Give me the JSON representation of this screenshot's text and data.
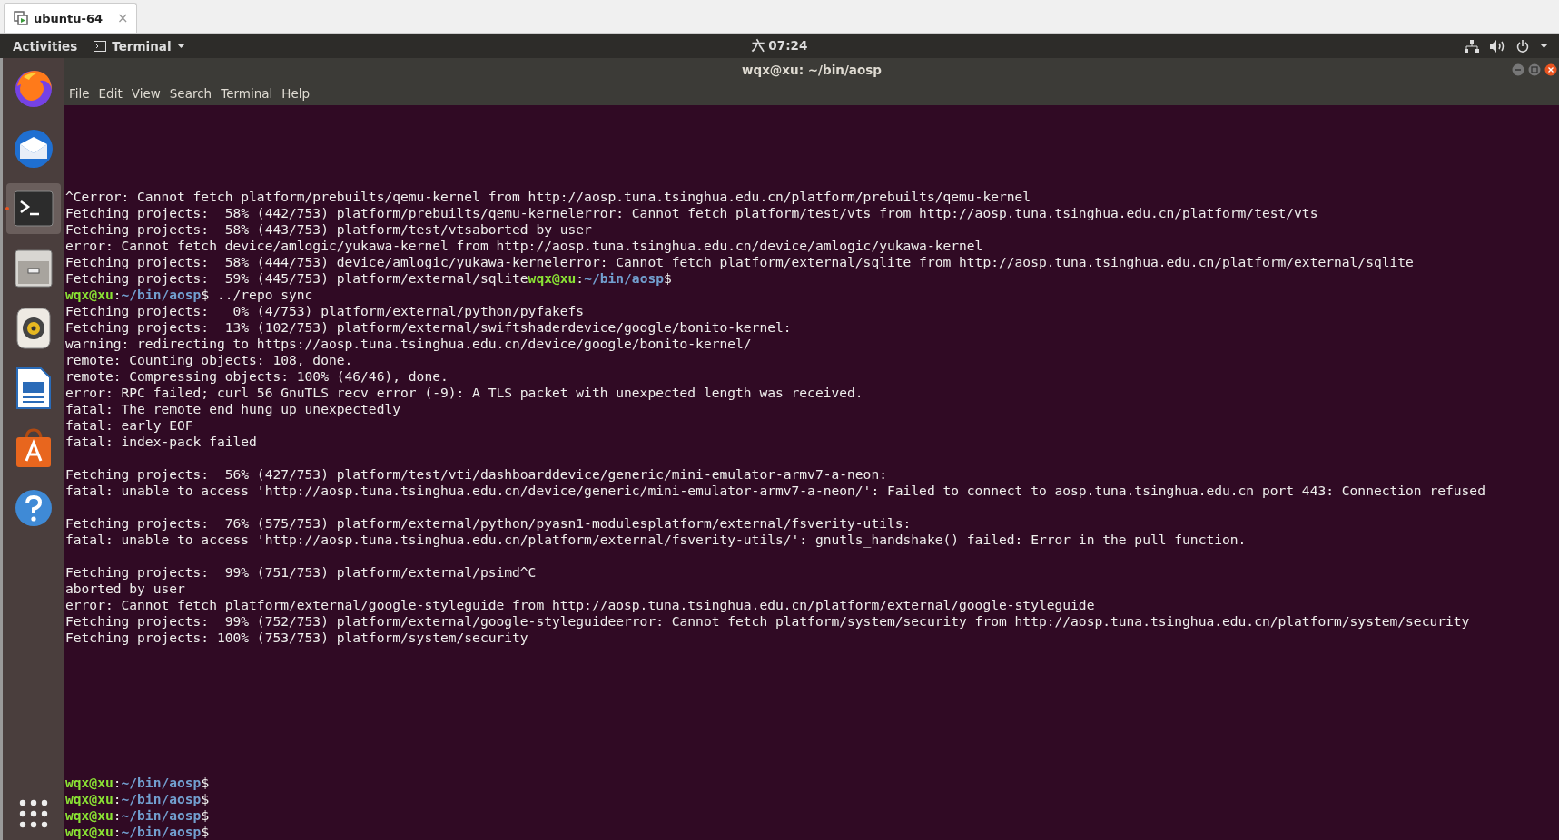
{
  "vm_tab": {
    "title": "ubuntu-64",
    "close": "×",
    "selected": true
  },
  "top_panel": {
    "activities": "Activities",
    "app_menu": "Terminal",
    "clock": "六 07:24"
  },
  "dock": [
    {
      "kind": "browser",
      "selected": false
    },
    {
      "kind": "mail",
      "selected": false
    },
    {
      "kind": "terminal",
      "selected": true
    },
    {
      "kind": "files",
      "selected": false
    },
    {
      "kind": "speaker",
      "selected": false
    },
    {
      "kind": "document",
      "selected": false
    },
    {
      "kind": "store",
      "selected": false
    },
    {
      "kind": "help",
      "selected": false
    }
  ],
  "window": {
    "title": "wqx@xu: ~/bin/aosp",
    "menu": [
      "File",
      "Edit",
      "View",
      "Search",
      "Terminal",
      "Help"
    ]
  },
  "terminal": {
    "blocks": [
      {
        "lines": [
          {
            "segments": [
              {
                "kind": "plain",
                "text": "^Cerror: Cannot fetch platform/prebuilts/qemu-kernel from http://aosp.tuna.tsinghua.edu.cn/platform/prebuilts/qemu-kernel"
              }
            ]
          },
          {
            "segments": [
              {
                "kind": "plain",
                "text": "Fetching projects:  58% (442/753) platform/prebuilts/qemu-kernelerror: Cannot fetch platform/test/vts from http://aosp.tuna.tsinghua.edu.cn/platform/test/vts"
              }
            ]
          },
          {
            "segments": [
              {
                "kind": "plain",
                "text": "Fetching projects:  58% (443/753) platform/test/vtsaborted by user"
              }
            ]
          },
          {
            "segments": [
              {
                "kind": "plain",
                "text": "error: Cannot fetch device/amlogic/yukawa-kernel from http://aosp.tuna.tsinghua.edu.cn/device/amlogic/yukawa-kernel"
              }
            ]
          },
          {
            "segments": [
              {
                "kind": "plain",
                "text": "Fetching projects:  58% (444/753) device/amlogic/yukawa-kernelerror: Cannot fetch platform/external/sqlite from http://aosp.tuna.tsinghua.edu.cn/platform/external/sqlite"
              }
            ]
          },
          {
            "segments": [
              {
                "kind": "plain",
                "text": "Fetching projects:  59% (445/753) platform/external/sqlite"
              },
              {
                "kind": "user",
                "text": "wqx@xu"
              },
              {
                "kind": "plain",
                "text": ":"
              },
              {
                "kind": "path",
                "text": "~/bin/aosp"
              },
              {
                "kind": "plain",
                "text": "$"
              }
            ]
          },
          {
            "segments": [
              {
                "kind": "user",
                "text": "wqx@xu"
              },
              {
                "kind": "plain",
                "text": ":"
              },
              {
                "kind": "path",
                "text": "~/bin/aosp"
              },
              {
                "kind": "plain",
                "text": "$ ../repo sync"
              }
            ]
          },
          {
            "segments": [
              {
                "kind": "plain",
                "text": "Fetching projects:   0% (4/753) platform/external/python/pyfakefs"
              }
            ]
          },
          {
            "segments": [
              {
                "kind": "plain",
                "text": "Fetching projects:  13% (102/753) platform/external/swiftshaderdevice/google/bonito-kernel:"
              }
            ]
          },
          {
            "segments": [
              {
                "kind": "plain",
                "text": "warning: redirecting to https://aosp.tuna.tsinghua.edu.cn/device/google/bonito-kernel/"
              }
            ]
          },
          {
            "segments": [
              {
                "kind": "plain",
                "text": "remote: Counting objects: 108, done."
              }
            ]
          },
          {
            "segments": [
              {
                "kind": "plain",
                "text": "remote: Compressing objects: 100% (46/46), done."
              }
            ]
          },
          {
            "segments": [
              {
                "kind": "plain",
                "text": "error: RPC failed; curl 56 GnuTLS recv error (-9): A TLS packet with unexpected length was received."
              }
            ]
          },
          {
            "segments": [
              {
                "kind": "plain",
                "text": "fatal: The remote end hung up unexpectedly"
              }
            ]
          },
          {
            "segments": [
              {
                "kind": "plain",
                "text": "fatal: early EOF"
              }
            ]
          },
          {
            "segments": [
              {
                "kind": "plain",
                "text": "fatal: index-pack failed"
              }
            ]
          }
        ]
      },
      {
        "lines": [
          {
            "segments": [
              {
                "kind": "plain",
                "text": "Fetching projects:  56% (427/753) platform/test/vti/dashboarddevice/generic/mini-emulator-armv7-a-neon:"
              }
            ]
          },
          {
            "segments": [
              {
                "kind": "plain",
                "text": "fatal: unable to access 'http://aosp.tuna.tsinghua.edu.cn/device/generic/mini-emulator-armv7-a-neon/': Failed to connect to aosp.tuna.tsinghua.edu.cn port 443: Connection refused"
              }
            ]
          }
        ]
      },
      {
        "lines": [
          {
            "segments": [
              {
                "kind": "plain",
                "text": "Fetching projects:  76% (575/753) platform/external/python/pyasn1-modulesplatform/external/fsverity-utils:"
              }
            ]
          },
          {
            "segments": [
              {
                "kind": "plain",
                "text": "fatal: unable to access 'http://aosp.tuna.tsinghua.edu.cn/platform/external/fsverity-utils/': gnutls_handshake() failed: Error in the pull function."
              }
            ]
          }
        ]
      },
      {
        "lines": [
          {
            "segments": [
              {
                "kind": "plain",
                "text": "Fetching projects:  99% (751/753) platform/external/psimd^C"
              }
            ]
          },
          {
            "segments": [
              {
                "kind": "plain",
                "text": "aborted by user"
              }
            ]
          },
          {
            "segments": [
              {
                "kind": "plain",
                "text": "error: Cannot fetch platform/external/google-styleguide from http://aosp.tuna.tsinghua.edu.cn/platform/external/google-styleguide"
              }
            ]
          },
          {
            "segments": [
              {
                "kind": "plain",
                "text": "Fetching projects:  99% (752/753) platform/external/google-styleguideerror: Cannot fetch platform/system/security from http://aosp.tuna.tsinghua.edu.cn/platform/system/security"
              }
            ]
          },
          {
            "segments": [
              {
                "kind": "plain",
                "text": "Fetching projects: 100% (753/753) platform/system/security"
              }
            ]
          }
        ]
      }
    ],
    "bottom_lines": [
      {
        "segments": [
          {
            "kind": "user",
            "text": "wqx@xu"
          },
          {
            "kind": "plain",
            "text": ":"
          },
          {
            "kind": "path",
            "text": "~/bin/aosp"
          },
          {
            "kind": "plain",
            "text": "$"
          }
        ]
      },
      {
        "segments": [
          {
            "kind": "user",
            "text": "wqx@xu"
          },
          {
            "kind": "plain",
            "text": ":"
          },
          {
            "kind": "path",
            "text": "~/bin/aosp"
          },
          {
            "kind": "plain",
            "text": "$"
          }
        ]
      },
      {
        "segments": [
          {
            "kind": "user",
            "text": "wqx@xu"
          },
          {
            "kind": "plain",
            "text": ":"
          },
          {
            "kind": "path",
            "text": "~/bin/aosp"
          },
          {
            "kind": "plain",
            "text": "$"
          }
        ]
      },
      {
        "segments": [
          {
            "kind": "user",
            "text": "wqx@xu"
          },
          {
            "kind": "plain",
            "text": ":"
          },
          {
            "kind": "path",
            "text": "~/bin/aosp"
          },
          {
            "kind": "plain",
            "text": "$"
          }
        ]
      }
    ]
  }
}
